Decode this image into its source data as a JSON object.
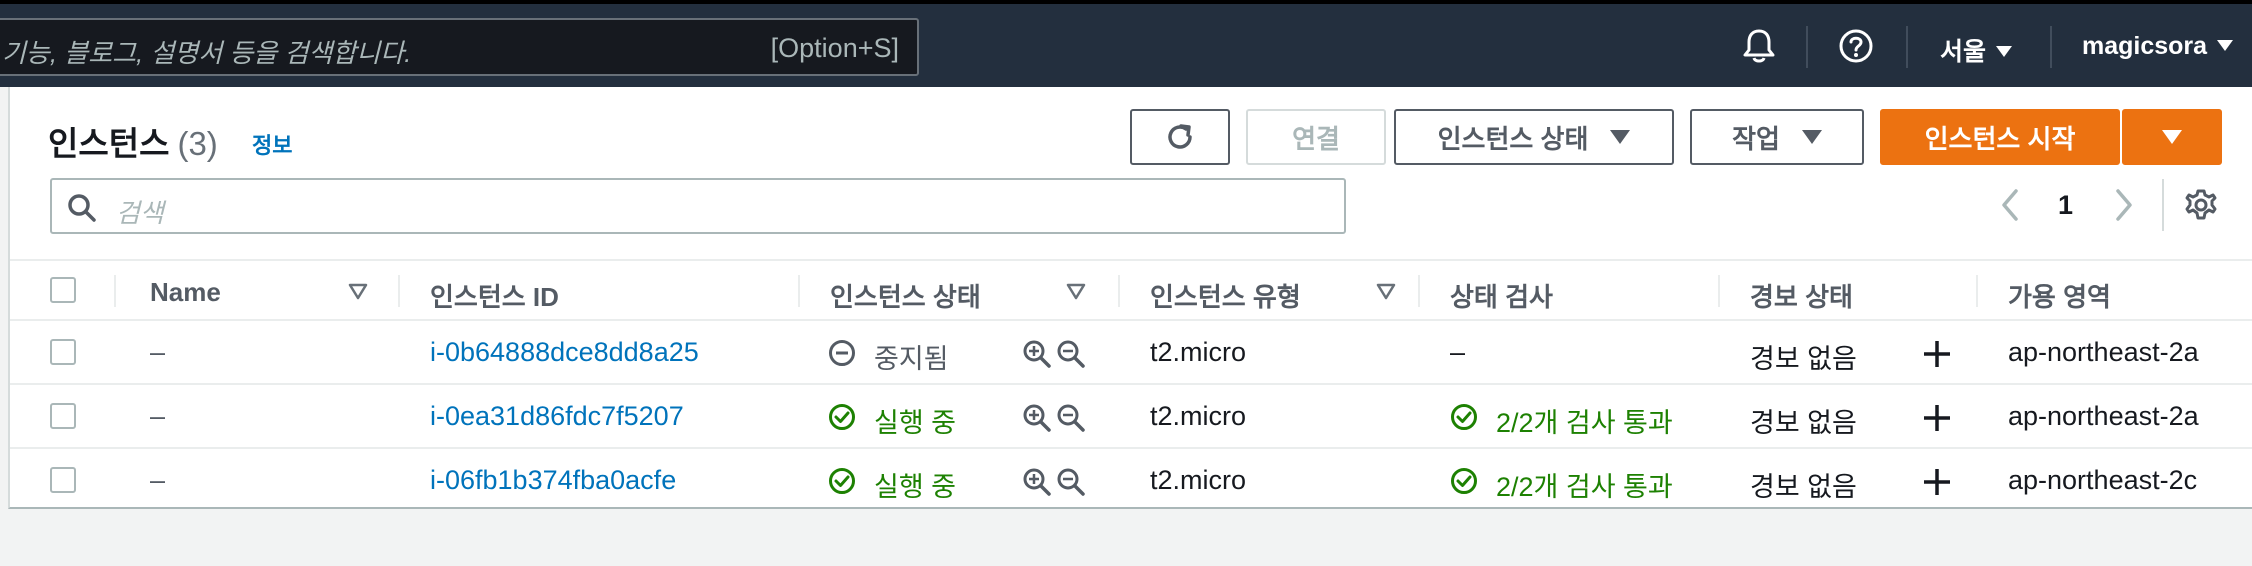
{
  "topnav": {
    "search_placeholder": "기능, 블로그, 설명서 등을 검색합니다.",
    "search_shortcut": "[Option+S]",
    "notifications_icon": "bell-icon",
    "help_icon": "question-circle-icon",
    "region": "서울",
    "account": "magicsora"
  },
  "panel": {
    "title": "인스턴스",
    "count": "(3)",
    "info_link": "정보",
    "refresh_icon": "refresh-icon",
    "connect_label": "연결",
    "instance_state_label": "인스턴스 상태",
    "actions_label": "작업",
    "launch_label": "인스턴스 시작",
    "filter_placeholder": "검색",
    "page_number": "1"
  },
  "table": {
    "headers": {
      "name": "Name",
      "instance_id": "인스턴스 ID",
      "instance_state": "인스턴스 상태",
      "instance_type": "인스턴스 유형",
      "status_check": "상태 검사",
      "alarm_status": "경보 상태",
      "availability_zone": "가용 영역"
    },
    "rows": [
      {
        "name": "–",
        "instance_id": "i-0b64888dce8dd8a25",
        "state": "중지됨",
        "state_kind": "stopped",
        "type": "t2.micro",
        "status_check": "–",
        "status_kind": "none",
        "alarm": "경보 없음",
        "zone": "ap-northeast-2a"
      },
      {
        "name": "–",
        "instance_id": "i-0ea31d86fdc7f5207",
        "state": "실행 중",
        "state_kind": "running",
        "type": "t2.micro",
        "status_check": "2/2개 검사 통과",
        "status_kind": "passed",
        "alarm": "경보 없음",
        "zone": "ap-northeast-2a"
      },
      {
        "name": "–",
        "instance_id": "i-06fb1b374fba0acfe",
        "state": "실행 중",
        "state_kind": "running",
        "type": "t2.micro",
        "status_check": "2/2개 검사 통과",
        "status_kind": "passed",
        "alarm": "경보 없음",
        "zone": "ap-northeast-2c"
      }
    ]
  },
  "colors": {
    "nav_bg": "#232f3e",
    "primary_button": "#ec7211",
    "link": "#0073bb",
    "success": "#1d8102"
  }
}
